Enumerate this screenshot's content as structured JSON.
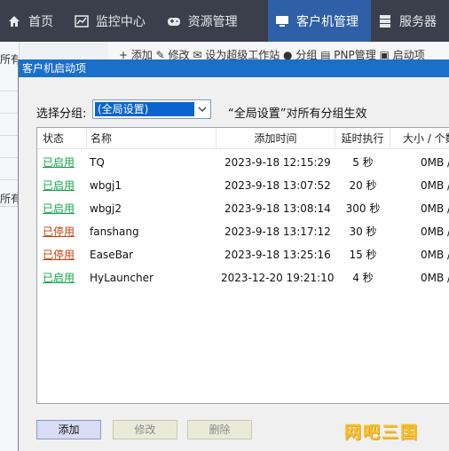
{
  "nav": {
    "home": "首页",
    "monitor": "监控中心",
    "resource": "资源管理",
    "client": "客户机管理",
    "server": "服务器"
  },
  "background": {
    "side_top": "所有客户机",
    "side_mid": "所有",
    "toolbar": "+ 添加  ✎ 修改  ✉ 设为超级工作站  ● 分组  ▤ PNP管理  ▣ 启动项"
  },
  "dialog": {
    "title": "客户机启动项",
    "group_label": "选择分组:",
    "group_value": "(全局设置)",
    "hint": "“全局设置”对所有分组生效",
    "columns": [
      "状态",
      "名称",
      "添加时间",
      "延时执行",
      "大小 / 个数"
    ],
    "rows": [
      {
        "status": "已启用",
        "enabled": true,
        "name": "TQ",
        "time": "2023-9-18 12:15:29",
        "delay": "5 秒",
        "size": "0MB /"
      },
      {
        "status": "已启用",
        "enabled": true,
        "name": "wbgj1",
        "time": "2023-9-18 13:07:52",
        "delay": "20 秒",
        "size": "0MB /"
      },
      {
        "status": "已启用",
        "enabled": true,
        "name": "wbgj2",
        "time": "2023-9-18 13:08:14",
        "delay": "300 秒",
        "size": "0MB /"
      },
      {
        "status": "已停用",
        "enabled": false,
        "name": "fanshang",
        "time": "2023-9-18 13:17:12",
        "delay": "30 秒",
        "size": "0MB /"
      },
      {
        "status": "已停用",
        "enabled": false,
        "name": "EaseBar",
        "time": "2023-9-18 13:25:16",
        "delay": "15 秒",
        "size": "0MB /"
      },
      {
        "status": "已启用",
        "enabled": true,
        "name": "HyLauncher",
        "time": "2023-12-20 19:21:10",
        "delay": "4 秒",
        "size": "0MB /"
      }
    ],
    "buttons": {
      "add": "添加",
      "edit": "修改",
      "delete": "删除"
    }
  },
  "watermark": "网吧三国",
  "colors": {
    "nav_bg": "#3a3f4b",
    "nav_active": "#2f5fa7",
    "title_bar": "#1b6fc8",
    "enabled": "#16a34a",
    "disabled": "#c2410c"
  }
}
